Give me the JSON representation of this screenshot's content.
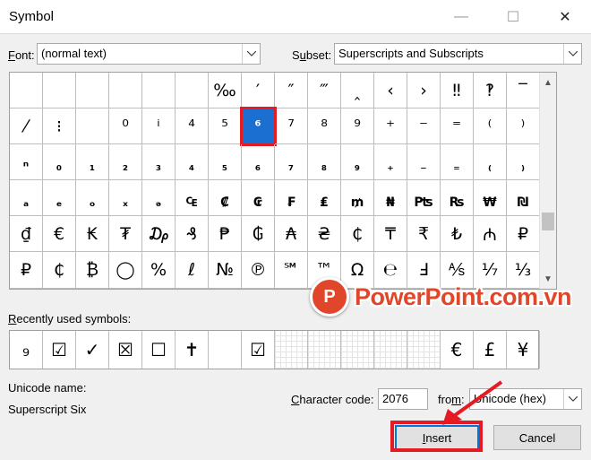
{
  "window": {
    "title": "Symbol",
    "minimize_icon": "minimize-icon",
    "maximize_icon": "maximize-icon",
    "close_icon": "close-icon"
  },
  "font": {
    "label_u": "F",
    "label_rest": "ont:",
    "value": "(normal text)"
  },
  "subset": {
    "label_pre": "S",
    "label_u": "u",
    "label_rest": "bset:",
    "value": "Superscripts and Subscripts"
  },
  "grid": {
    "rows": [
      [
        "",
        "",
        "",
        "",
        "",
        "",
        "‰",
        "′",
        "″",
        "‴",
        "‸",
        "‹",
        "›",
        "‼",
        "‽",
        "‾"
      ],
      [
        "⁄",
        "⁝",
        "",
        "⁰",
        "ⁱ",
        "⁴",
        "⁵",
        "⁶",
        "⁷",
        "⁸",
        "⁹",
        "⁺",
        "⁻",
        "⁼",
        "⁽",
        "⁾"
      ],
      [
        "ⁿ",
        "₀",
        "₁",
        "₂",
        "₃",
        "₄",
        "₅",
        "₆",
        "₇",
        "₈",
        "₉",
        "₊",
        "₋",
        "₌",
        "₍",
        "₎"
      ],
      [
        "ₐ",
        "ₑ",
        "ₒ",
        "ₓ",
        "ₔ",
        "₠",
        "₡",
        "₢",
        "₣",
        "₤",
        "₥",
        "₦",
        "₧",
        "₨",
        "₩",
        "₪"
      ],
      [
        "₫",
        "€",
        "₭",
        "₮",
        "₯",
        "₰",
        "₱",
        "₲",
        "₳",
        "₴",
        "₵",
        "₸",
        "₹",
        "₺",
        "₼",
        "₽"
      ],
      [
        "₽",
        "₵",
        "₿",
        "◯",
        "%",
        "ℓ",
        "№",
        "℗",
        "℠",
        "™",
        "Ω",
        "℮",
        "Ⅎ",
        "⅍",
        "⅐",
        "⅓"
      ]
    ],
    "selected": "⁶"
  },
  "recent": {
    "label_u": "R",
    "label_rest": "ecently used symbols:",
    "items": [
      "₉",
      "☑",
      "✓",
      "☒",
      "☐",
      "✝",
      "",
      "☑",
      "",
      "",
      "",
      "",
      "",
      "€",
      "£",
      "¥"
    ]
  },
  "unicode_name": {
    "label": "Unicode name:",
    "value": "Superscript Six"
  },
  "character_code": {
    "label_u": "C",
    "label_rest": "haracter code:",
    "value": "2076"
  },
  "from": {
    "label_pre": "fro",
    "label_u": "m",
    "label_rest": ":",
    "value": "Unicode (hex)"
  },
  "buttons": {
    "insert_u": "I",
    "insert_rest": "nsert",
    "cancel": "Cancel"
  },
  "watermark": {
    "logo": "P",
    "text": "PowerPoint.com.vn"
  },
  "colors": {
    "selection": "#1a6fd1",
    "highlight": "#e51b24"
  }
}
